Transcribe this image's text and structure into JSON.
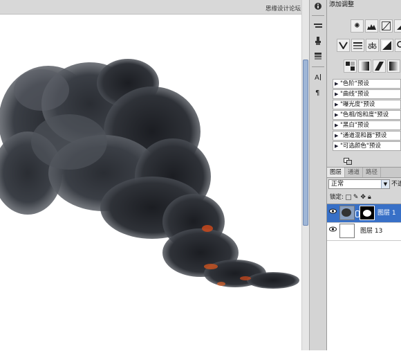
{
  "watermark": {
    "text": "思缘设计论坛 WWW.MISSYUAN.COM"
  },
  "adjustments": {
    "title": "添加调整",
    "presets": [
      {
        "label": "\"色阶\"预设"
      },
      {
        "label": "\"曲线\"预设"
      },
      {
        "label": "\"曝光度\"预设"
      },
      {
        "label": "\"色相/饱和度\"预设"
      },
      {
        "label": "\"黑白\"预设"
      },
      {
        "label": "\"通道混和器\"预设"
      },
      {
        "label": "\"可选颜色\"预设"
      }
    ]
  },
  "layers_panel": {
    "tabs": [
      {
        "label": "图层"
      },
      {
        "label": "通道"
      },
      {
        "label": "路径"
      }
    ],
    "blend_mode": "正常",
    "opacity_label": "不透",
    "lock_label": "锁定:",
    "layers": [
      {
        "name": "图层 1",
        "selected": true
      },
      {
        "name": "图层 13",
        "selected": false
      }
    ]
  },
  "icons": [
    "smoke-image",
    "info-icon",
    "brush-tools-icon",
    "clone-icon",
    "layer-comps-icon",
    "character-icon",
    "paragraph-icon",
    "eye-icon",
    "lock-icon"
  ]
}
